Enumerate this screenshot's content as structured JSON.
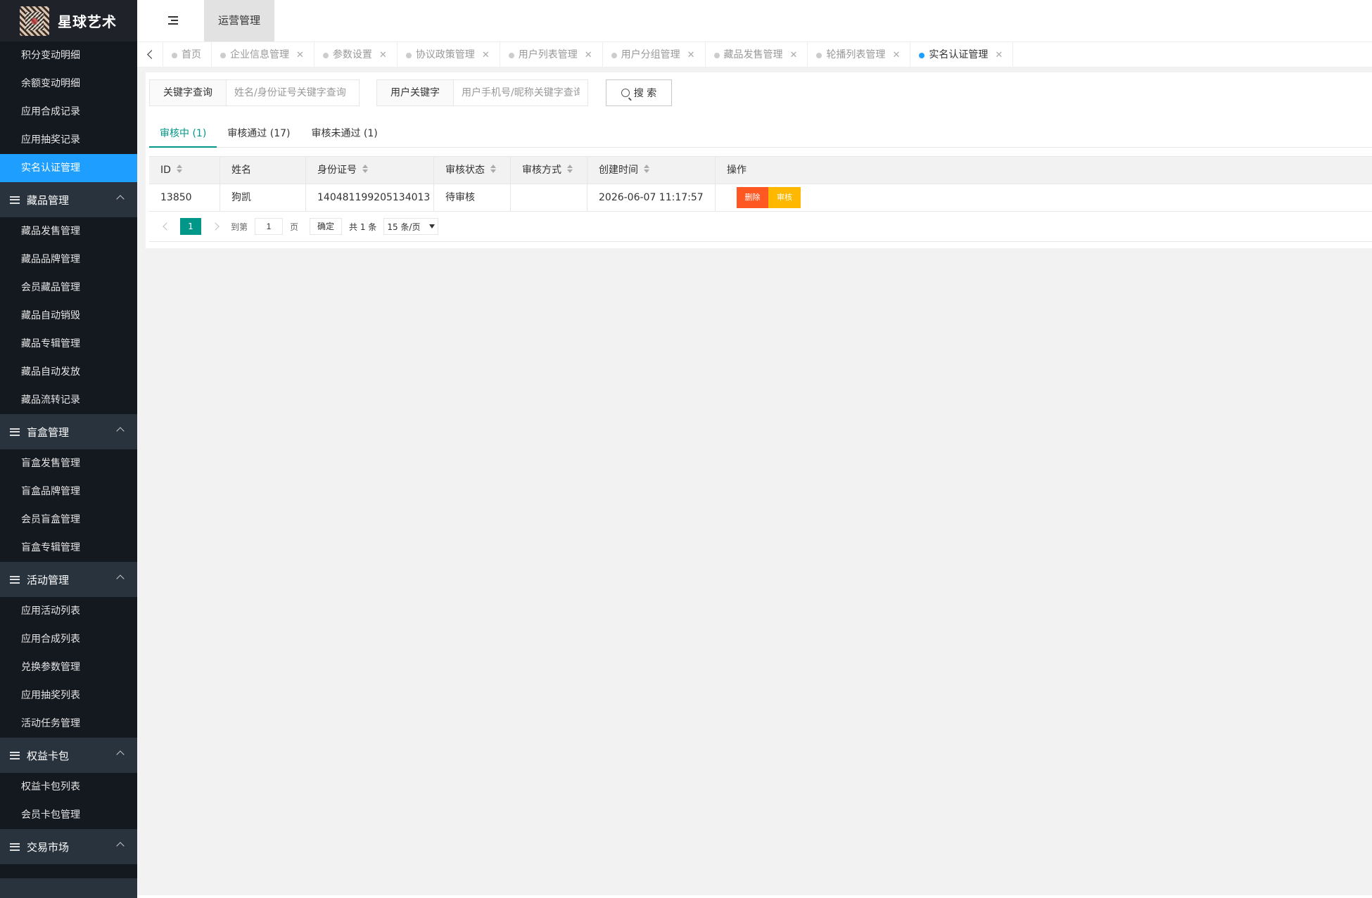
{
  "app": {
    "title": "星球艺术"
  },
  "header": {
    "active_tab": "运营管理"
  },
  "sidebar": {
    "top_items": [
      {
        "label": "积分变动明细"
      },
      {
        "label": "余额变动明细"
      },
      {
        "label": "应用合成记录"
      },
      {
        "label": "应用抽奖记录"
      },
      {
        "label": "实名认证管理",
        "active": true
      }
    ],
    "groups": [
      {
        "label": "藏品管理",
        "items": [
          "藏品发售管理",
          "藏品品牌管理",
          "会员藏品管理",
          "藏品自动销毁",
          "藏品专辑管理",
          "藏品自动发放",
          "藏品流转记录"
        ]
      },
      {
        "label": "盲盒管理",
        "items": [
          "盲盒发售管理",
          "盲盒品牌管理",
          "会员盲盒管理",
          "盲盒专辑管理"
        ]
      },
      {
        "label": "活动管理",
        "items": [
          "应用活动列表",
          "应用合成列表",
          "兑换参数管理",
          "应用抽奖列表",
          "活动任务管理"
        ]
      },
      {
        "label": "权益卡包",
        "items": [
          "权益卡包列表",
          "会员卡包管理"
        ]
      },
      {
        "label": "交易市场",
        "items": []
      }
    ]
  },
  "tabs": [
    {
      "label": "首页",
      "closable": false
    },
    {
      "label": "企业信息管理",
      "closable": true
    },
    {
      "label": "参数设置",
      "closable": true
    },
    {
      "label": "协议政策管理",
      "closable": true
    },
    {
      "label": "用户列表管理",
      "closable": true
    },
    {
      "label": "用户分组管理",
      "closable": true
    },
    {
      "label": "藏品发售管理",
      "closable": true
    },
    {
      "label": "轮播列表管理",
      "closable": true
    },
    {
      "label": "实名认证管理",
      "closable": true,
      "active": true
    }
  ],
  "search": {
    "keyword_label": "关键字查询",
    "keyword_placeholder": "姓名/身份证号关键字查询",
    "user_label": "用户关键字",
    "user_placeholder": "用户手机号/昵称关键字查询",
    "button_label": "搜 索"
  },
  "status_tabs": [
    {
      "label": "审核中 (1)",
      "active": true
    },
    {
      "label": "审核通过 (17)"
    },
    {
      "label": "审核未通过 (1)"
    }
  ],
  "table": {
    "headers": [
      {
        "label": "ID",
        "sortable": true
      },
      {
        "label": "姓名",
        "sortable": false
      },
      {
        "label": "身份证号",
        "sortable": true
      },
      {
        "label": "审核状态",
        "sortable": true
      },
      {
        "label": "审核方式",
        "sortable": true
      },
      {
        "label": "创建时间",
        "sortable": true
      },
      {
        "label": "操作",
        "sortable": false
      }
    ],
    "rows": [
      {
        "id": "13850",
        "name": "狗凯",
        "id_number": "140481199205134013",
        "status": "待审核",
        "method": "",
        "created": "2026-06-07 11:17:57"
      }
    ],
    "actions": {
      "delete": "删除",
      "audit": "审核"
    }
  },
  "pagination": {
    "current_page": "1",
    "goto_prefix": "到第",
    "goto_value": "1",
    "goto_suffix": "页",
    "confirm": "确定",
    "total": "共 1 条",
    "page_size": "15 条/页"
  },
  "colors": {
    "sidebar_bg": "#28333e",
    "active_menu": "#1e9fff",
    "primary": "#009688",
    "danger": "#ff5722",
    "warn": "#ffb800"
  }
}
